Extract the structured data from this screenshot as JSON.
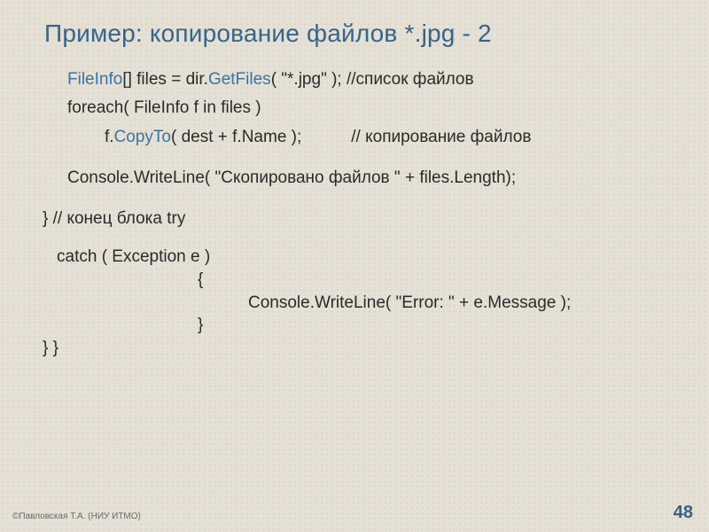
{
  "title": "Пример: копирование файлов *.jpg - 2",
  "code": {
    "l1a": "FileInfo",
    "l1b": "[] files = dir.",
    "l1c": "GetFiles",
    "l1d": "( \"*.jpg\" ); //список файлов",
    "l2": "foreach( FileInfo f in files )",
    "l3a": "f.",
    "l3b": "CopyTo",
    "l3c": "( dest + f.Name );",
    "l3d": "// копирование файлов",
    "l4": "Console.WriteLine( \"Скопировано файлов \" + files.Length);",
    "l5": "}    // конец блока try",
    "l6": "catch ( Exception e )",
    "l7": "{",
    "l8": "Console.WriteLine( \"Error: \" + e.Message );",
    "l9": "}",
    "l10": "} }"
  },
  "footer": "©Павловская Т.А. (НИУ ИТМО)",
  "page": "48"
}
